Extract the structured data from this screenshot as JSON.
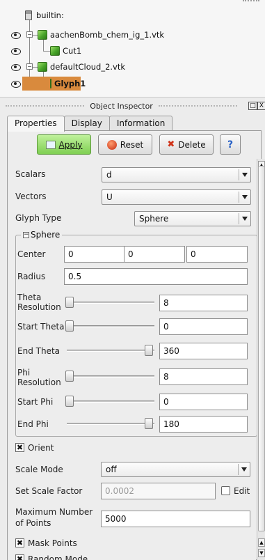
{
  "pipeline": {
    "items": [
      {
        "label": "builtin:"
      },
      {
        "label": "aachenBomb_chem_ig_1.vtk"
      },
      {
        "label": "Cut1"
      },
      {
        "label": "defaultCloud_2.vtk"
      },
      {
        "label": "Glyph1"
      }
    ],
    "selected_color": "#d98a3d"
  },
  "dock": {
    "title": "Object Inspector",
    "float_label": "□",
    "close_label": "X"
  },
  "tabs": [
    {
      "label": "Properties"
    },
    {
      "label": "Display"
    },
    {
      "label": "Information"
    }
  ],
  "buttons": {
    "apply": "Apply",
    "reset": "Reset",
    "delete": "Delete",
    "help": "?"
  },
  "props": {
    "scalars": {
      "label": "Scalars",
      "value": "d"
    },
    "vectors": {
      "label": "Vectors",
      "value": "U"
    },
    "glyph_type": {
      "label": "Glyph Type",
      "value": "Sphere"
    },
    "sphere": {
      "title": "Sphere",
      "center": {
        "label": "Center",
        "values": [
          "0",
          "0",
          "0"
        ]
      },
      "radius": {
        "label": "Radius",
        "value": "0.5"
      },
      "theta_resolution": {
        "label": "Theta Resolution",
        "value": "8",
        "slider_fraction": 0
      },
      "start_theta": {
        "label": "Start Theta",
        "value": "0",
        "slider_fraction": 0
      },
      "end_theta": {
        "label": "End Theta",
        "value": "360",
        "slider_fraction": 1
      },
      "phi_resolution": {
        "label": "Phi Resolution",
        "value": "8",
        "slider_fraction": 0
      },
      "start_phi": {
        "label": "Start Phi",
        "value": "0",
        "slider_fraction": 0
      },
      "end_phi": {
        "label": "End Phi",
        "value": "180",
        "slider_fraction": 1
      }
    },
    "orient": {
      "label": "Orient",
      "checked": true
    },
    "scale_mode": {
      "label": "Scale Mode",
      "value": "off"
    },
    "scale_factor": {
      "label": "Set Scale Factor",
      "value": "0.0002",
      "edit_label": "Edit"
    },
    "max_points": {
      "label": "Maximum Number of Points",
      "value": "5000"
    },
    "mask_points": {
      "label": "Mask Points",
      "checked": true
    },
    "random_mode": {
      "label": "Random Mode",
      "checked": true
    }
  }
}
